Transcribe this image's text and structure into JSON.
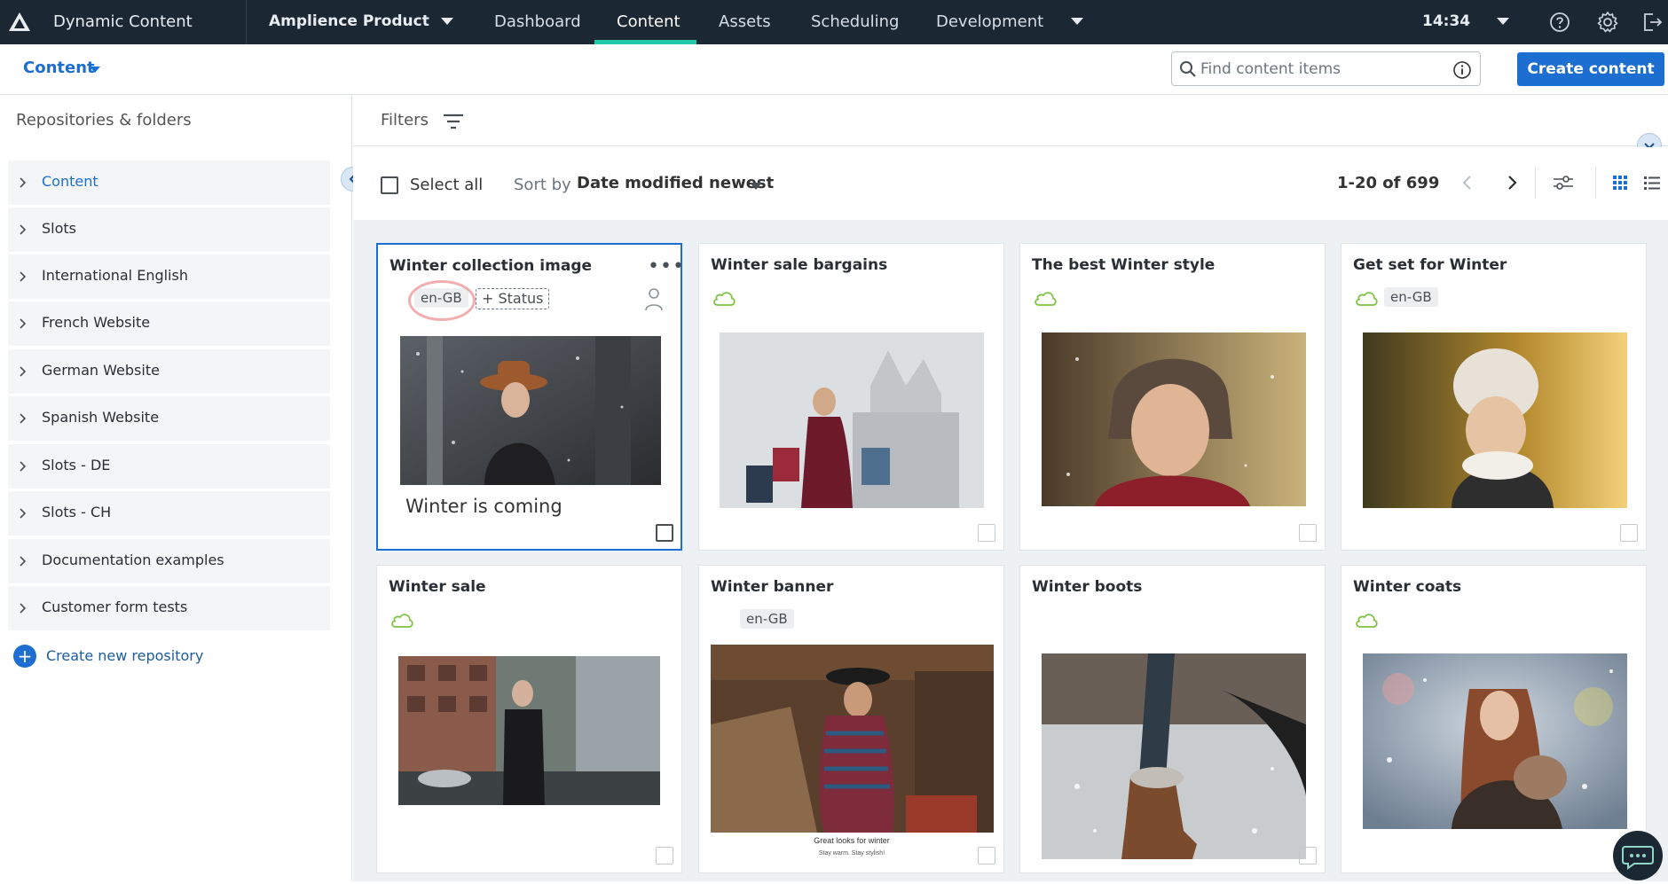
{
  "topbar": {
    "app_title": "Dynamic Content",
    "hub_name": "Amplience Product",
    "nav": [
      "Dashboard",
      "Content",
      "Assets",
      "Scheduling",
      "Development"
    ],
    "active_nav": "Content",
    "time": "14:34"
  },
  "subbar": {
    "breadcrumb": "Content",
    "search_placeholder": "Find content items",
    "create_button": "Create content"
  },
  "sidebar": {
    "title": "Repositories & folders",
    "items": [
      "Content",
      "Slots",
      "International English",
      "French Website",
      "German Website",
      "Spanish Website",
      "Slots - DE",
      "Slots - CH",
      "Documentation examples",
      "Customer form tests"
    ],
    "create_repo": "Create new repository"
  },
  "filters": {
    "label": "Filters"
  },
  "toolbar": {
    "select_all": "Select all",
    "sort_by": "Sort by",
    "sort_value": "Date modified newest",
    "paging": "1-20 of 699"
  },
  "cards": [
    {
      "title": "Winter collection image",
      "locale": "en-GB",
      "status": "+ Status",
      "caption": "Winter is coming"
    },
    {
      "title": "Winter sale bargains"
    },
    {
      "title": "The best Winter style"
    },
    {
      "title": "Get set for Winter",
      "locale": "en-GB"
    },
    {
      "title": "Winter sale"
    },
    {
      "title": "Winter banner",
      "locale": "en-GB",
      "banner_line1": "Great looks for winter",
      "banner_line2": "Stay warm. Stay stylish!"
    },
    {
      "title": "Winter boots"
    },
    {
      "title": "Winter coats"
    }
  ],
  "colors": {
    "accent": "#1c6fd0",
    "nav_bg": "#1b2733",
    "active_underline": "#22c9a8",
    "cloud": "#7dc243"
  }
}
